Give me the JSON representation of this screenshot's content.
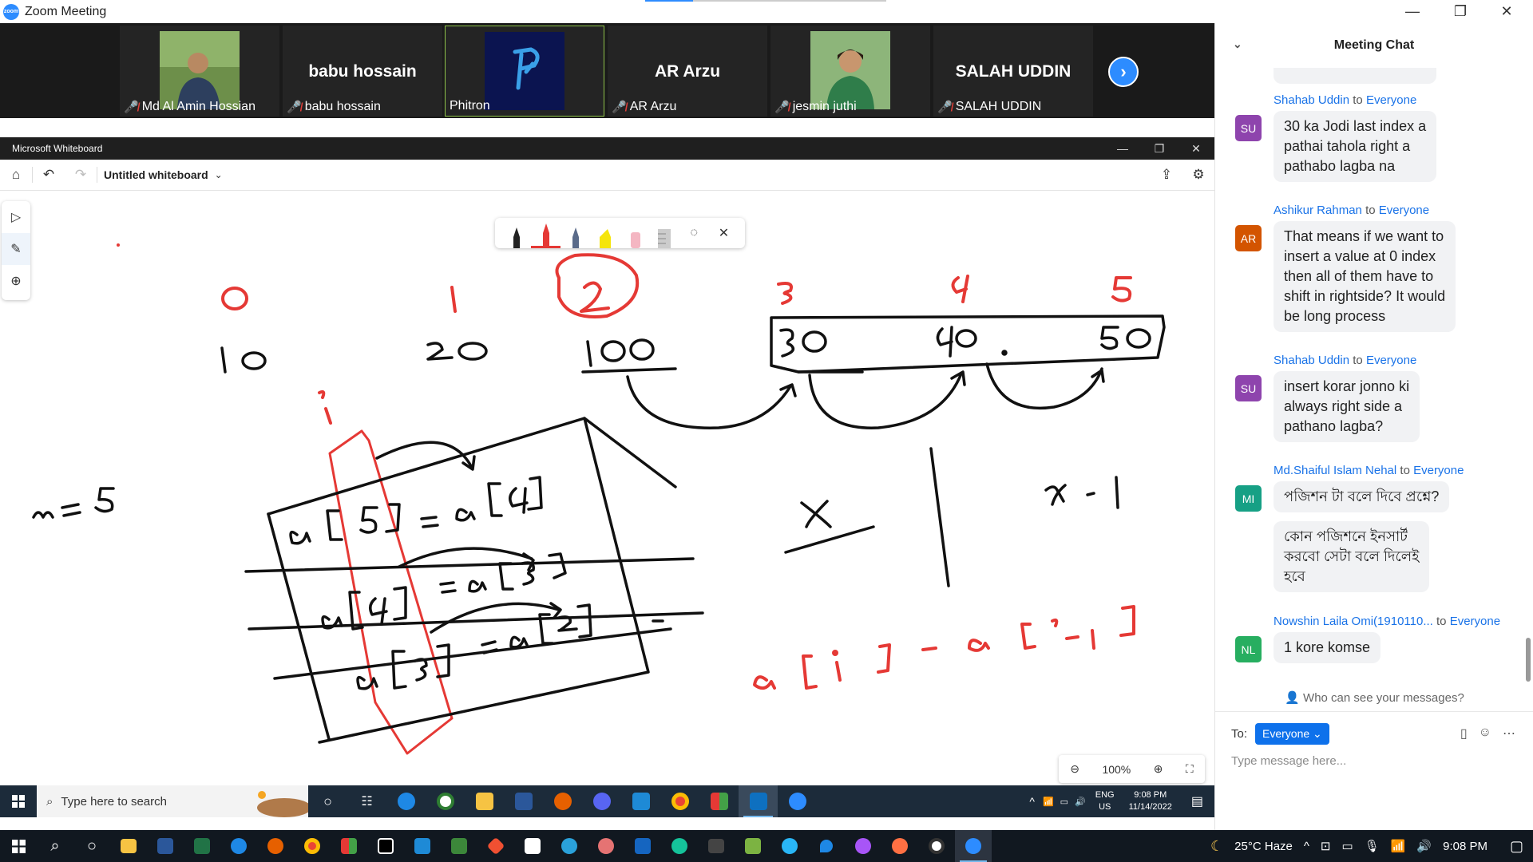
{
  "zoom": {
    "title": "Zoom Meeting"
  },
  "participants": [
    {
      "name": "Md Al Amin Hossian",
      "display": "",
      "muted": true
    },
    {
      "name": "babu hossain",
      "display": "babu hossain",
      "muted": true
    },
    {
      "name": "Phitron",
      "display": "",
      "muted": false
    },
    {
      "name": "AR Arzu",
      "display": "AR Arzu",
      "muted": true
    },
    {
      "name": "jesmin juthi",
      "display": "",
      "muted": true
    },
    {
      "name": "SALAH UDDIN",
      "display": "SALAH UDDIN",
      "muted": true
    }
  ],
  "whiteboard": {
    "app_title": "Microsoft Whiteboard",
    "board_title": "Untitled whiteboard",
    "zoom_level": "100%",
    "drawing": {
      "indices": [
        "0",
        "1",
        "2",
        "3",
        "4",
        "5"
      ],
      "values": [
        "10",
        "20",
        "100",
        "30",
        "40",
        "50"
      ],
      "n_label": "n = 5",
      "rows": [
        {
          "left": "a [5]",
          "right": "= a [4]"
        },
        {
          "left": "a [4]",
          "right": "= a [3]"
        },
        {
          "left": "a [3]",
          "right": "= a [2]"
        }
      ],
      "x_label": "x",
      "x_minus_1": "x - 1",
      "formula": "a [i] = a [i-1]",
      "i_label": "i"
    }
  },
  "inner_taskbar": {
    "search_placeholder": "Type here to search",
    "lang": "ENG",
    "region": "US",
    "time": "9:08 PM",
    "date": "11/14/2022"
  },
  "outer_taskbar": {
    "weather": "25°C  Haze",
    "time": "9:08 PM"
  },
  "chat": {
    "title": "Meeting Chat",
    "messages": [
      {
        "initials": "SU",
        "sender": "Shahab Uddin",
        "to": "to",
        "target": "Everyone",
        "color": "#8e44ad",
        "lines": [
          "30 ka Jodi last index a",
          "pathai tahola right a",
          "pathabo lagba na"
        ]
      },
      {
        "initials": "AR",
        "sender": "Ashikur Rahman",
        "to": "to",
        "target": "Everyone",
        "color": "#d35400",
        "lines": [
          "That means if we want to",
          "insert a value at 0 index",
          "then all of them have to",
          "shift in rightside? It would",
          "be long process"
        ]
      },
      {
        "initials": "SU",
        "sender": "Shahab Uddin",
        "to": "to",
        "target": "Everyone",
        "color": "#8e44ad",
        "lines": [
          "insert korar jonno ki",
          "always right side a",
          "pathano lagba?"
        ]
      },
      {
        "initials": "MI",
        "sender": "Md.Shaiful Islam Nehal",
        "to": "to",
        "target": "Everyone",
        "color": "#16a085",
        "lines": [
          "পজিশন টা বলে দিবে প্রশ্নে?"
        ],
        "lines2": [
          "কোন পজিশনে ইনসার্ট",
          "করবো সেটা বলে দিলেই",
          "হবে"
        ]
      },
      {
        "initials": "NL",
        "sender": "Nowshin Laila Omi(1910110...",
        "to": "to",
        "target": "Everyone",
        "color": "#27ae60",
        "lines": [
          "1 kore komse"
        ]
      }
    ],
    "who_can_see": "Who can see your messages?",
    "to_label": "To:",
    "to_value": "Everyone",
    "input_placeholder": "Type message here..."
  }
}
